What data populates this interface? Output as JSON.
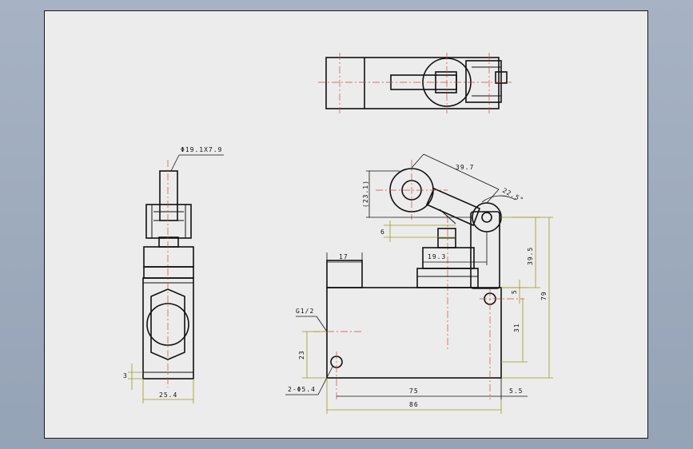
{
  "colors": {
    "background": "#9eabbe",
    "sheet": "#ececec",
    "outline": "#111111",
    "centerline": "#d24a3a",
    "dimension": "#9a9a20"
  },
  "annotations": {
    "roller_spec": "Φ19.1X7.9",
    "dim_39_7": "39.7",
    "dim_23_1": "(23.1)",
    "dim_22_5": "22.5°",
    "dim_6": "6",
    "dim_17": "17",
    "dim_19_3": "19.3",
    "dim_39_5": "39.5",
    "dim_79": "79",
    "dim_5": "5",
    "dim_31": "31",
    "dim_23": "23",
    "thread": "G1/2",
    "hole_spec": "2-Φ5.4",
    "dim_75": "75",
    "dim_5_5": "5.5",
    "dim_86": "86",
    "dim_3": "3",
    "dim_25_4": "25.4"
  }
}
